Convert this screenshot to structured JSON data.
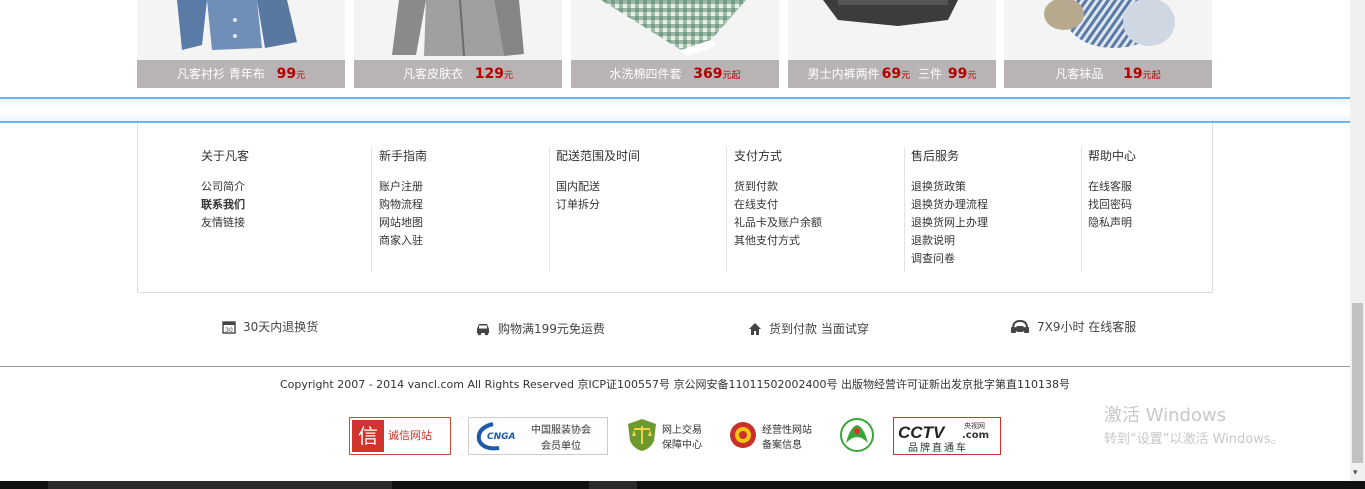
{
  "products": [
    {
      "name": "凡客衬衫 青年布",
      "price": "99",
      "unit": "元"
    },
    {
      "name": "凡客皮肤衣",
      "price": "129",
      "unit": "元"
    },
    {
      "name": "水洗棉四件套",
      "price": "369",
      "unit": "元起"
    },
    {
      "name": "男士内裤两件",
      "price": "69",
      "unit": "元",
      "mid": "三件",
      "price2": "99",
      "unit2": "元"
    },
    {
      "name": "凡客袜品",
      "price": "19",
      "unit": "元起"
    }
  ],
  "help": [
    {
      "title": "关于凡客",
      "links": [
        "公司简介",
        "联系我们",
        "友情链接"
      ]
    },
    {
      "title": "新手指南",
      "links": [
        "账户注册",
        "购物流程",
        "网站地图",
        "商家入驻"
      ]
    },
    {
      "title": "配送范围及时间",
      "links": [
        "国内配送",
        "订单拆分"
      ]
    },
    {
      "title": "支付方式",
      "links": [
        "货到付款",
        "在线支付",
        "礼品卡及账户余额",
        "其他支付方式"
      ]
    },
    {
      "title": "售后服务",
      "links": [
        "退换货政策",
        "退换货办理流程",
        "退换货网上办理",
        "退款说明",
        "调查问卷"
      ]
    },
    {
      "title": "帮助中心",
      "links": [
        "在线客服",
        "找回密码",
        "隐私声明"
      ]
    }
  ],
  "services": {
    "return": "30天内退换货",
    "shipping": "购物满199元免运费",
    "cod": "货到付款 当面试穿",
    "support": "7X9小时 在线客服"
  },
  "copyright": "Copyright 2007 - 2014 vancl.com All Rights Reserved 京ICP证100557号 京公网安备11011502002400号 出版物经营许可证新出发京批字第直110138号",
  "badges": {
    "xin_char": "信",
    "xin_text": "诚信网站",
    "cnga_logo": "CNGA",
    "cnga_line1": "中国服装协会",
    "cnga_line2": "会员单位",
    "jy_line1": "网上交易",
    "jy_line2": "保障中心",
    "jj_line1": "经营性网站",
    "jj_line2": "备案信息",
    "cctv_logo": "CCTV",
    "cctv_site": "央视网",
    "cctv_com": ".com",
    "cctv_line2": "品牌直通车"
  },
  "watermark": {
    "line1": "激活 Windows",
    "line2": "转到“设置”以激活 Windows。"
  },
  "colors": {
    "accent_blue": "#6fb3ec",
    "price_red": "#b30000",
    "caption_bg": "#b8b3b5"
  }
}
